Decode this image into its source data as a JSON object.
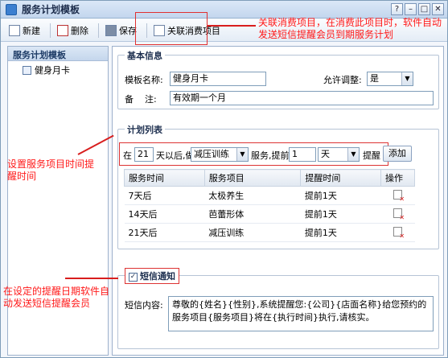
{
  "window": {
    "title": "服务计划模板",
    "controls": [
      "?",
      "–",
      "□",
      "✕"
    ]
  },
  "toolbar": {
    "new_label": "新建",
    "delete_label": "删除",
    "save_label": "保存",
    "link_label": "关联消费项目"
  },
  "sidebar": {
    "header": "服务计划模板",
    "items": [
      {
        "label": "健身月卡"
      }
    ]
  },
  "basic": {
    "title": "基本信息",
    "name_label": "模板名称:",
    "name_value": "健身月卡",
    "allow_label": "允许调整:",
    "allow_value": "是",
    "note_label": "备    注:",
    "note_value": "有效期一个月"
  },
  "plan": {
    "title": "计划列表",
    "in_label": "在",
    "days_value": "21",
    "after_label": "天以后,做",
    "item_value": "减压训练",
    "service_remind_label": "服务,提前",
    "remind_value": "1",
    "unit_value": "天",
    "remind_label": "提醒",
    "add_label": "添加",
    "columns": [
      "服务时间",
      "服务项目",
      "提醒时间",
      "操作"
    ],
    "rows": [
      {
        "time": "7天后",
        "item": "太极养生",
        "remind": "提前1天"
      },
      {
        "time": "14天后",
        "item": "芭蕾形体",
        "remind": "提前1天"
      },
      {
        "time": "21天后",
        "item": "减压训练",
        "remind": "提前1天"
      }
    ]
  },
  "sms": {
    "title": "短信通知",
    "checked": true,
    "content_label": "短信内容:",
    "content_value": "尊敬的{姓名}{性别},系统提醒您:{公司}{店面名称}给您预约的服务项目{服务项目}将在{执行时间}执行,请核实。"
  },
  "annotations": {
    "top": "关联消费项目，在消费此项目时，软件自动发送短信提醒会员到期服务计划",
    "middle": "设置服务项目时间提醒时间",
    "bottom": "在设定的提醒日期软件自动发送短信提醒会员"
  },
  "colors": {
    "annotation": "#ff1a1a",
    "accent": "#1d3b66"
  }
}
